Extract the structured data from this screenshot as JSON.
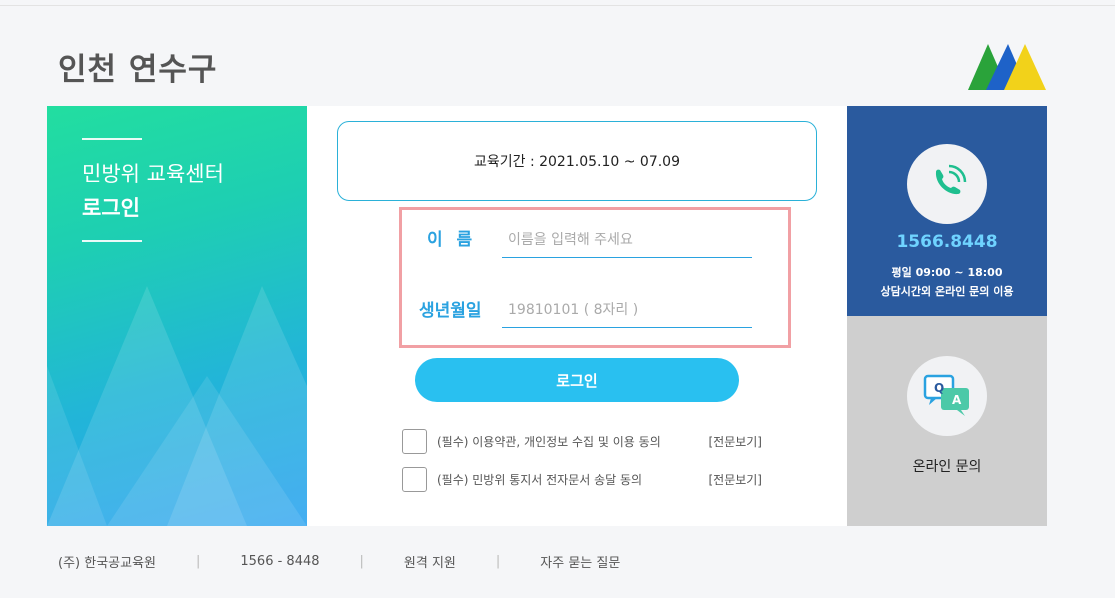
{
  "header": {
    "title": "인천 연수구"
  },
  "left_panel": {
    "subtitle": "민방위 교육센터",
    "title": "로그인"
  },
  "center": {
    "period_label": "교육기간 : 2021.05.10 ~ 07.09",
    "name_label": "이  름",
    "name_placeholder": "이름을 입력해 주세요",
    "birth_label": "생년월일",
    "birth_placeholder": "19810101 ( 8자리 )",
    "login_button": "로그인",
    "agreements": [
      {
        "text": "(필수) 이용약관, 개인정보 수집 및 이용 동의",
        "link": "[전문보기]"
      },
      {
        "text": "(필수) 민방위 통지서 전자문서 송달 동의",
        "link": "[전문보기]"
      }
    ]
  },
  "right_panel": {
    "phone": "1566.8448",
    "hours": "평일 09:00 ~ 18:00",
    "note": "상담시간외 온라인 문의 이용",
    "qa_label": "온라인 문의",
    "qa_icon_q": "Q",
    "qa_icon_a": "A"
  },
  "footer": {
    "company": "(주) 한국공교육원",
    "phone": "1566 - 8448",
    "remote": "원격 지원",
    "faq": "자주 묻는 질문",
    "separator": "|"
  },
  "colors": {
    "accent": "#29c0f0",
    "phone_panel": "#2a5a9e",
    "highlight_border": "#f1a0a4",
    "qa_panel": "#cfcfcf"
  },
  "icons": [
    "logo-mountains-icon",
    "phone-icon",
    "qa-chat-icon"
  ]
}
